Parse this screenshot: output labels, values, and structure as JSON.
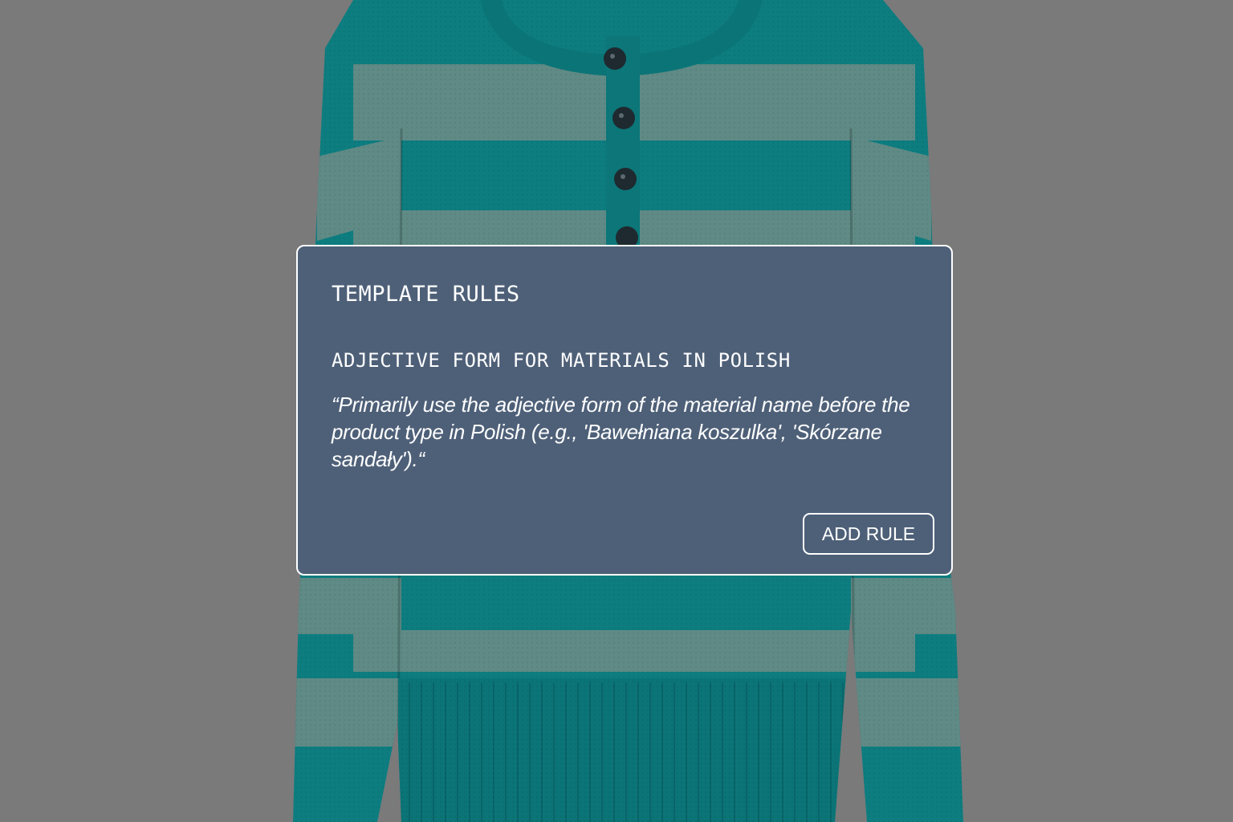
{
  "background": {
    "image": "striped-sweater-product-photo",
    "sweater_colors": {
      "teal": "#0d7d80",
      "grey_green": "#5f8a85",
      "dimmed_backdrop": "#7a7a7a"
    }
  },
  "modal": {
    "title": "TEMPLATE RULES",
    "rule_name": "ADJECTIVE FORM FOR MATERIALS IN POLISH",
    "rule_text": "“Primarily use the adjective form of the material name before the product type in Polish (e.g., 'Bawełniana koszulka', 'Skórzane sandały').“",
    "add_button_label": "ADD RULE",
    "background_color": "#4e6078",
    "border_color": "#ffffff"
  }
}
